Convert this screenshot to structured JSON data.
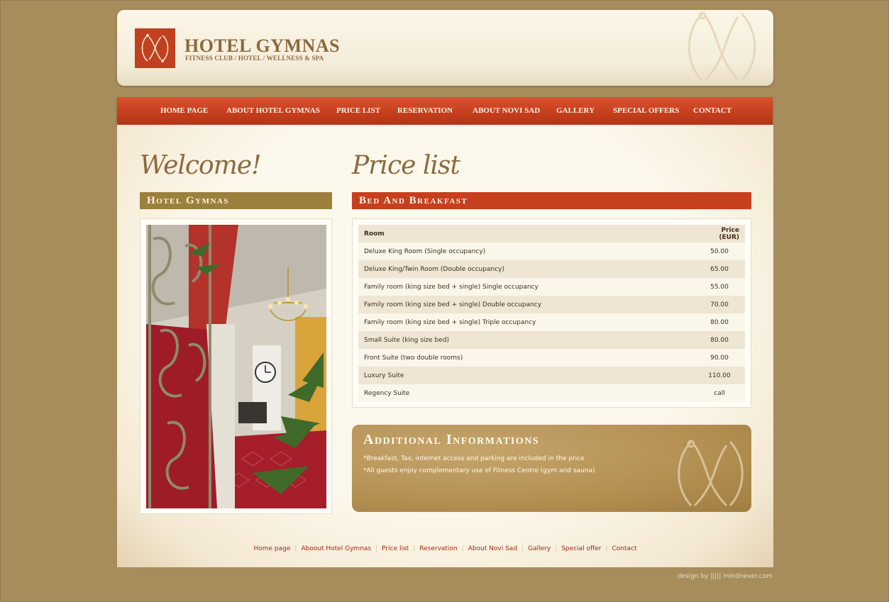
{
  "brand": {
    "name": "HOTEL GYMNAS",
    "tagline": "FITNESS CLUB / HOTEL / WELLNESS & SPA",
    "accent": "#c1401f",
    "text_color": "#8b6a3e"
  },
  "nav": {
    "items": [
      {
        "label": "HOME PAGE"
      },
      {
        "label": "ABOUT HOTEL GYMNAS"
      },
      {
        "label": "PRICE LIST"
      },
      {
        "label": "RESERVATION"
      },
      {
        "label": "ABOUT NOVI SAD"
      },
      {
        "label": "GALLERY"
      },
      {
        "label": "SPECIAL OFFERS"
      },
      {
        "label": "CONTACT"
      }
    ]
  },
  "left": {
    "title": "Welcome!",
    "section": "Hotel Gymnas"
  },
  "right": {
    "title": "Price list",
    "section": "Bed And Breakfast",
    "table": {
      "headers": [
        "Room",
        "Price (EUR)"
      ],
      "rows": [
        [
          "Deluxe King Room (Single occupancy)",
          "50.00"
        ],
        [
          "Deluxe King/Twin Room (Double occupancy)",
          "65.00"
        ],
        [
          "Family room (king size bed + single) Single occupancy",
          "55.00"
        ],
        [
          "Family room (king size bed + single) Double occupancy",
          "70.00"
        ],
        [
          "Family room (king size bed + single) Triple occupancy",
          "80.00"
        ],
        [
          "Small Suite (king size bed)",
          "80.00"
        ],
        [
          "Front Suite (two double rooms)",
          "90.00"
        ],
        [
          "Luxury Suite",
          "110.00"
        ],
        [
          "Regency Suite",
          "call"
        ]
      ]
    }
  },
  "info": {
    "title": "Additional Informations",
    "lines": [
      "*Breakfast, Tax, internet access and parking are included in the price",
      "*All guests enjoy complementary use of Fitness Centre (gym and sauna)"
    ]
  },
  "footer": {
    "links": [
      "Home page",
      "Aboout Hotel Gymnas",
      "Price list",
      "Reservation",
      "About Novi Sad",
      "Gallery",
      "Special offer",
      "Contact"
    ],
    "credit": "design by ||||| mindnever.com"
  }
}
